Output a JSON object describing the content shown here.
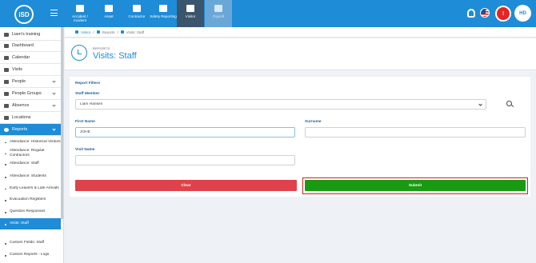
{
  "topbar": {
    "logo": "iSD",
    "modules": [
      {
        "label": "Accident / Incident"
      },
      {
        "label": "Asset"
      },
      {
        "label": "Contractor"
      },
      {
        "label": "Safety Reporting"
      },
      {
        "label": "Visitor"
      },
      {
        "label": "Payroll"
      }
    ],
    "alarm": "!",
    "avatar": "HD",
    "icons": {
      "notifications": "bell-icon",
      "language": "us-flag-icon",
      "alarm": "fire-alarm-icon"
    }
  },
  "sidebar": {
    "top": "Liam's training",
    "items": [
      {
        "label": "Dashboard"
      },
      {
        "label": "Calendar"
      },
      {
        "label": "Visits"
      },
      {
        "label": "People"
      },
      {
        "label": "People Groups"
      },
      {
        "label": "Absence"
      },
      {
        "label": "Locations"
      },
      {
        "label": "Reports"
      }
    ],
    "reports": [
      {
        "label": "Attendance: Historical Visitors"
      },
      {
        "label": "Attendance: Regular Contractors"
      },
      {
        "label": "Attendance: Staff"
      },
      {
        "label": "Attendance: Students"
      },
      {
        "label": "Early Leavers & Late Arrivals"
      },
      {
        "label": "Evacuation Registers"
      },
      {
        "label": "Question Responses"
      },
      {
        "label": "Visits: Staff"
      },
      {
        "label": "Custom Fields: Staff"
      },
      {
        "label": "Custom Reports - Logs"
      }
    ]
  },
  "breadcrumb": [
    "Visitor",
    "Reports",
    "Visits: Staff"
  ],
  "page": {
    "section": "REPORTS",
    "title": "Visits: Staff"
  },
  "filters": {
    "heading": "Report Filters",
    "staff_member_label": "Staff Member",
    "staff_member_value": "Liam Hansen",
    "first_name_label": "First Name",
    "first_name_value": "JOHE",
    "surname_label": "Surname",
    "surname_value": "",
    "visit_name_label": "Visit Name",
    "visit_name_value": ""
  },
  "buttons": {
    "clear": "Clear",
    "submit": "Submit"
  },
  "colors": {
    "primary": "#1e8cd6",
    "clear": "#e0424b",
    "submit": "#1a9a12",
    "highlight": "#d71f1f"
  }
}
